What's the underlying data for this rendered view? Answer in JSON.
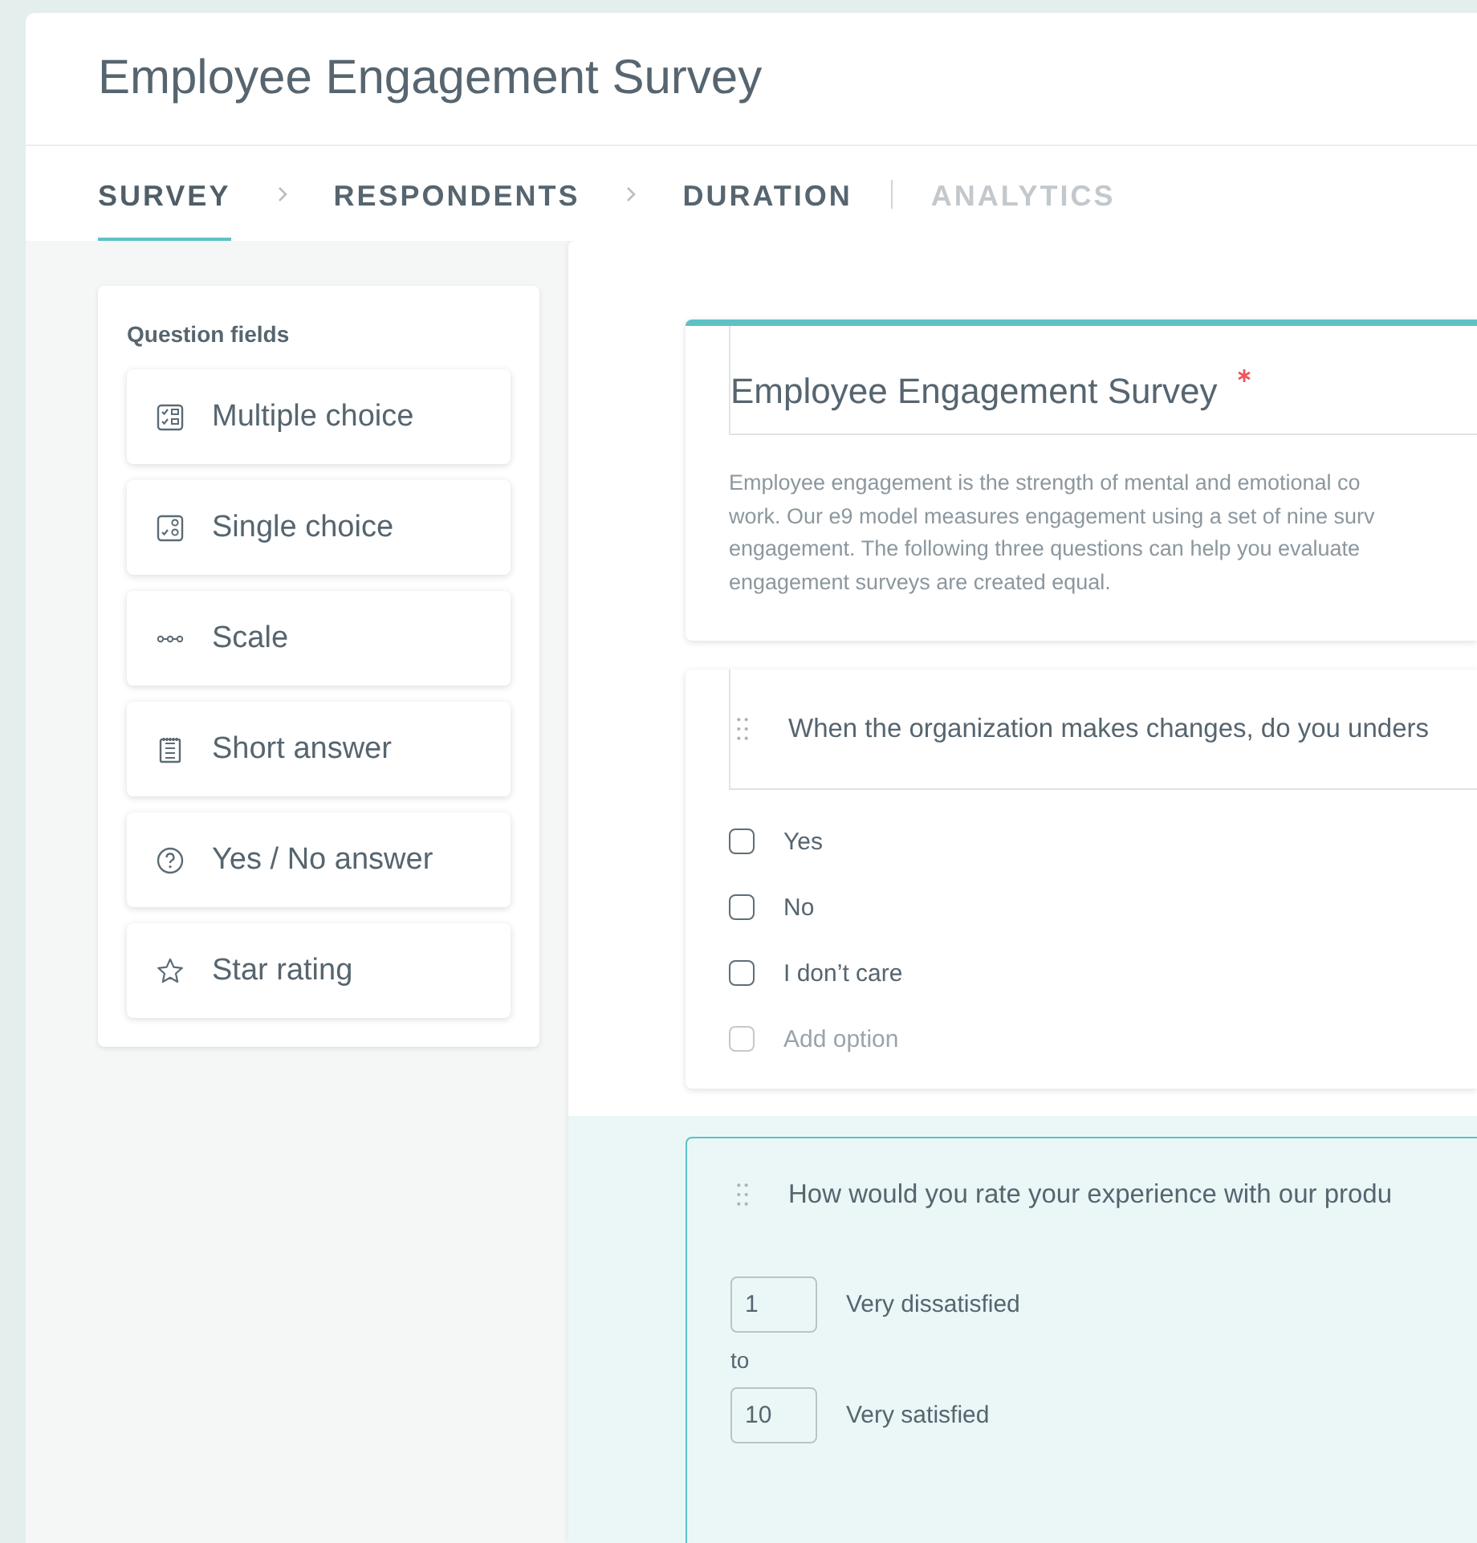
{
  "header": {
    "title": "Employee Engagement Survey"
  },
  "tabs": [
    {
      "label": "SURVEY",
      "selected": true,
      "disabled": false
    },
    {
      "label": "RESPONDENTS",
      "selected": false,
      "disabled": false
    },
    {
      "label": "DURATION",
      "selected": false,
      "disabled": false
    },
    {
      "label": "ANALYTICS",
      "selected": false,
      "disabled": true
    }
  ],
  "sidebar": {
    "title": "Question fields",
    "items": [
      {
        "label": "Multiple choice",
        "kind": "multiple"
      },
      {
        "label": "Single choice",
        "kind": "single"
      },
      {
        "label": "Scale",
        "kind": "scale"
      },
      {
        "label": "Short answer",
        "kind": "short"
      },
      {
        "label": "Yes / No answer",
        "kind": "yesno"
      },
      {
        "label": "Star rating",
        "kind": "star"
      }
    ]
  },
  "form": {
    "title": "Employee Engagement Survey",
    "required": true,
    "description": "Employee engagement is the strength of mental and emotional co\nwork. Our e9 model measures engagement using a set of nine surv\nengagement. The following three questions can help you evaluate\nengagement surveys are created equal."
  },
  "questions": [
    {
      "kind": "choice",
      "selected": false,
      "text": "When the organization makes changes, do you unders",
      "options": [
        {
          "label": "Yes",
          "checked": false
        },
        {
          "label": "No",
          "checked": false
        },
        {
          "label": "I don’t care",
          "checked": false
        }
      ],
      "add_option": "Add option"
    },
    {
      "kind": "scale",
      "selected": true,
      "text": "How would you rate your experience with our produ",
      "from": {
        "value": "1",
        "label": "Very dissatisfied"
      },
      "to_word": "to",
      "to": {
        "value": "10",
        "label": "Very satisfied"
      }
    }
  ]
}
